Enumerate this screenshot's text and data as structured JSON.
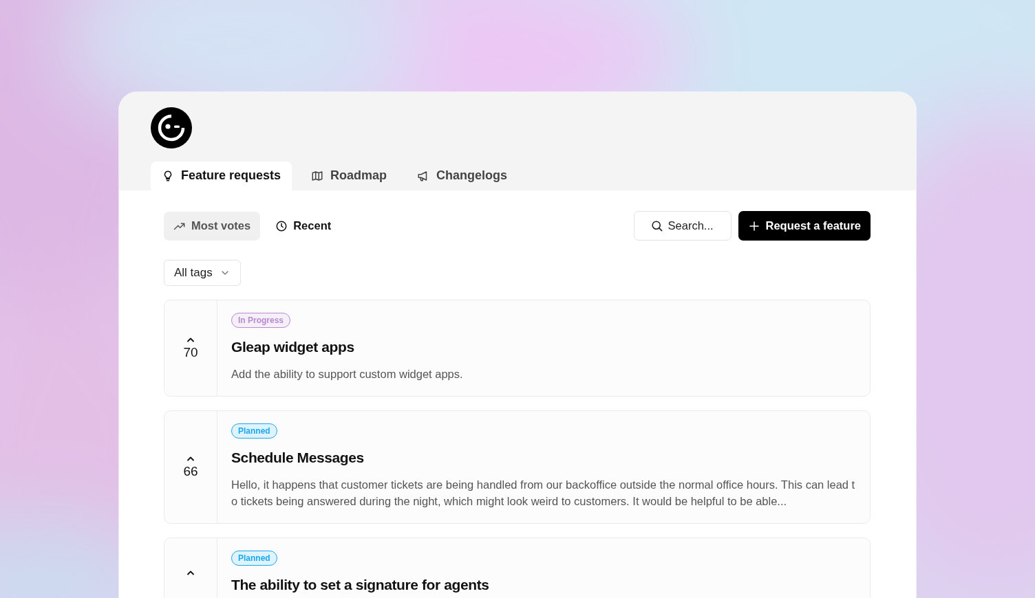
{
  "tabs": [
    {
      "label": "Feature requests",
      "selected": true
    },
    {
      "label": "Roadmap",
      "selected": false
    },
    {
      "label": "Changelogs",
      "selected": false
    }
  ],
  "sort_options": [
    {
      "label": "Most votes",
      "selected": true
    },
    {
      "label": "Recent",
      "selected": false
    }
  ],
  "search": {
    "placeholder": "Search..."
  },
  "request_button": "Request a feature",
  "tag_filter": "All tags",
  "requests": [
    {
      "status": "In Progress",
      "color": "#b98ad0",
      "votes": "70",
      "title": "Gleap widget apps",
      "description": "Add the ability to support custom widget apps."
    },
    {
      "status": "Planned",
      "color": "#1ba8f0",
      "votes": "66",
      "title": "Schedule Messages",
      "description": "Hello, it happens that customer tickets are being handled from our backoffice outside the normal office hours. This can lead to tickets being answered during the night, which might look weird to customers. It would be helpful to be able..."
    },
    {
      "status": "Planned",
      "color": "#1ba8f0",
      "title": "The ability to set a signature for agents"
    }
  ]
}
